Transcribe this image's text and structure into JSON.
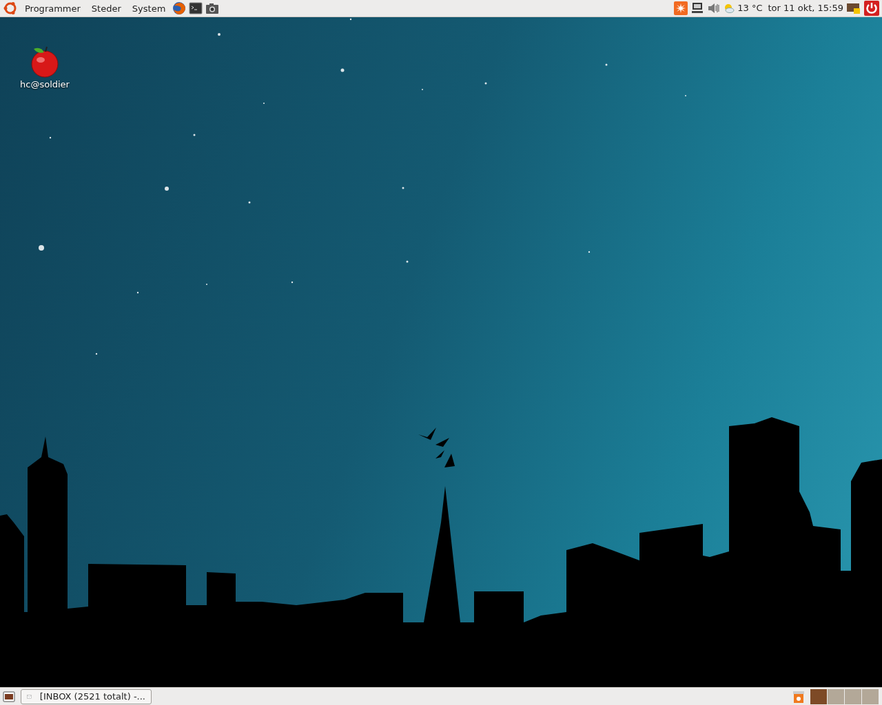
{
  "top_panel": {
    "menus": [
      "Programmer",
      "Steder",
      "System"
    ],
    "weather": "13 °C",
    "clock": "tor 11 okt, 15:59"
  },
  "desktop_icons": [
    {
      "label": "hc@soldier"
    }
  ],
  "bottom_panel": {
    "windows": [
      {
        "title": "[INBOX (2521 totalt) -...",
        "selected": false
      }
    ],
    "workspaces": [
      {
        "selected": true
      },
      {
        "selected": false
      },
      {
        "selected": false
      },
      {
        "selected": false
      }
    ]
  }
}
